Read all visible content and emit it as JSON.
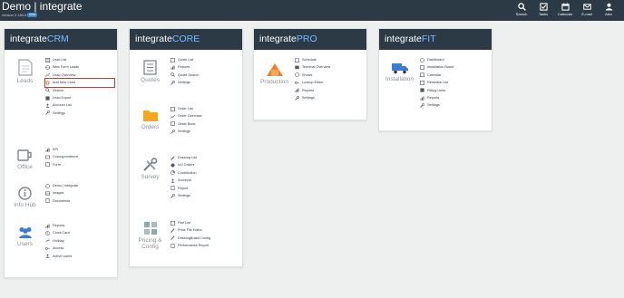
{
  "header": {
    "title": "Demo | integrate",
    "version": "version 2.183.6",
    "badge": "beta",
    "tools": [
      {
        "label": "Search",
        "icon": "search-icon"
      },
      {
        "label": "Tasks",
        "icon": "tasks-icon"
      },
      {
        "label": "Calendar",
        "icon": "calendar-icon"
      },
      {
        "label": "E-mail",
        "icon": "email-icon"
      },
      {
        "label": "Alex",
        "icon": "user-icon"
      }
    ]
  },
  "cards": {
    "crm": {
      "title_prefix": "integrate",
      "title_suffix": "CRM",
      "groups": {
        "leads": {
          "label": "Leads",
          "items": [
            "Lead List",
            "Web Form Leads",
            "Lead Overview",
            "Add New Lead",
            "Search",
            "Lead Export",
            "Account List",
            "Settings"
          ]
        },
        "office": {
          "label": "Office",
          "items": [
            "KPI",
            "Correspondence",
            "Form"
          ]
        },
        "infohub": {
          "label": "Info Hub",
          "items": [
            "Demo | integrate",
            "Images",
            "Documents"
          ]
        },
        "users": {
          "label": "Users",
          "items": [
            "Reports",
            "Clock Card",
            "Holiday",
            "Access",
            "Active Users"
          ]
        }
      }
    },
    "core": {
      "title_prefix": "integrate",
      "title_suffix": "CORE",
      "groups": {
        "quotes": {
          "label": "Quotes",
          "items": [
            "Quote List",
            "Reports",
            "Quote Search",
            "Settings"
          ]
        },
        "orders": {
          "label": "Orders",
          "items": [
            "Order List",
            "Order Overview",
            "Order Book",
            "Settings"
          ]
        },
        "survey": {
          "label": "Survey",
          "items": [
            "Drawing List",
            "N/J Orders",
            "Contribution",
            "Surveyor",
            "Report",
            "Settings"
          ]
        },
        "pricing": {
          "label": "Pricing & Config",
          "items": [
            "Part List",
            "Price File Editor",
            "DrawingBoard Config",
            "Performance Report"
          ]
        }
      }
    },
    "pro": {
      "title_prefix": "integrate",
      "title_suffix": "PRO",
      "groups": {
        "production": {
          "label": "Production",
          "items": [
            "Schedule",
            "Terminal Overview",
            "Shows",
            "Lookup Editor",
            "Reports",
            "Settings"
          ]
        }
      }
    },
    "fit": {
      "title_prefix": "integrate",
      "title_suffix": "FIT",
      "groups": {
        "installation": {
          "label": "Installation",
          "items": [
            "Dashboard",
            "Installation Board",
            "Calendar",
            "Remedial List",
            "Fitting Units",
            "Reports",
            "Settings"
          ]
        }
      }
    }
  },
  "highlighted_item": "Add New Lead"
}
